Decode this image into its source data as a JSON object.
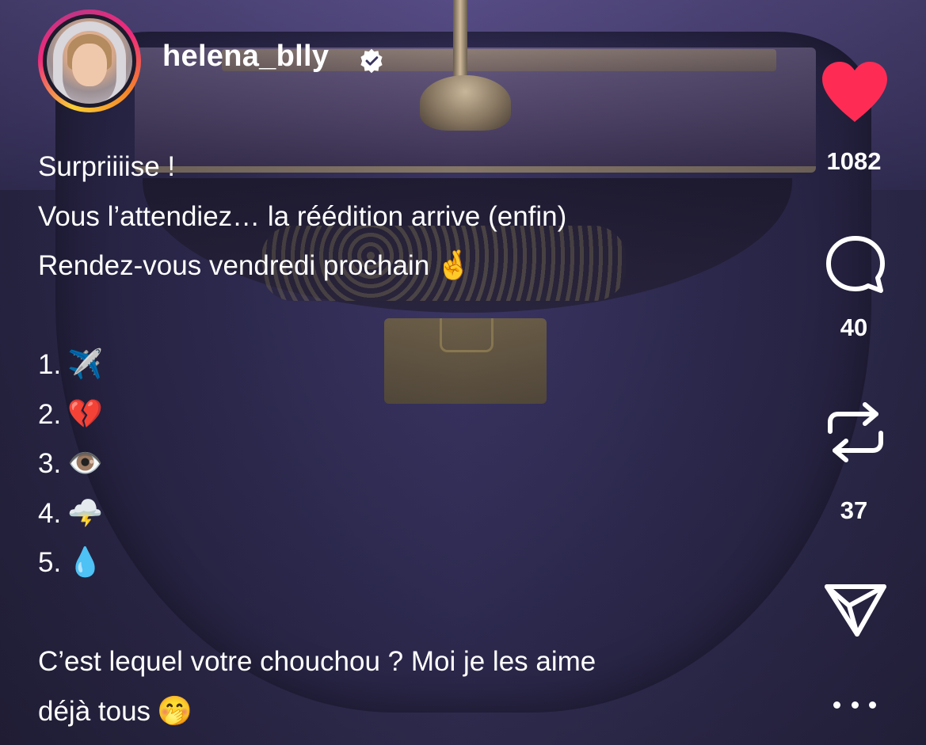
{
  "post": {
    "username": "helena_blly",
    "verified": true,
    "caption": {
      "line1": "Surpriiiise !",
      "line2": "Vous l’attendiez… la réédition arrive (enfin)",
      "line3": "Rendez-vous vendredi prochain",
      "line3_emoji": "🤞",
      "list": [
        {
          "number": "1.",
          "emoji": "✈️"
        },
        {
          "number": "2.",
          "emoji": "💔"
        },
        {
          "number": "3.",
          "emoji": "👁️"
        },
        {
          "number": "4.",
          "emoji": "🌩️"
        },
        {
          "number": "5.",
          "emoji": "💧"
        }
      ],
      "line_final1": "C’est lequel votre chouchou ? Moi je les aime",
      "line_final2": "déjà tous",
      "line_final2_emoji": "🤭"
    }
  },
  "actions": {
    "like": {
      "icon": "heart-filled-icon",
      "count": "1082",
      "color": "#fe2c55"
    },
    "comment": {
      "icon": "comment-bubble-icon",
      "count": "40"
    },
    "repost": {
      "icon": "repost-icon",
      "count": "37"
    },
    "share": {
      "icon": "paper-plane-icon"
    },
    "more": {
      "icon": "more-dots-icon"
    }
  },
  "colors": {
    "avatar_ring_start": "#f9ce34",
    "avatar_ring_mid": "#ee2a7b",
    "avatar_ring_end": "#c13584",
    "background": "#2a2745",
    "text": "#ffffff"
  }
}
